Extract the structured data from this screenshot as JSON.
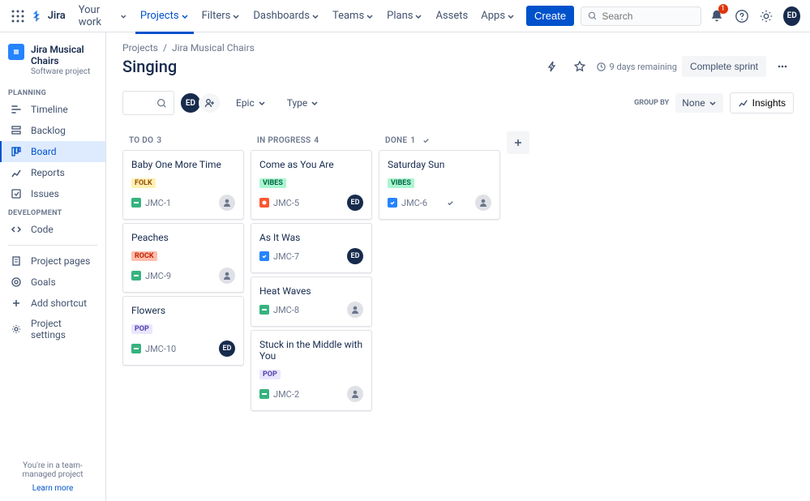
{
  "nav": {
    "logo": "Jira",
    "items": [
      "Your work",
      "Projects",
      "Filters",
      "Dashboards",
      "Teams",
      "Plans",
      "Assets",
      "Apps"
    ],
    "create": "Create",
    "search_placeholder": "Search",
    "notification_count": "1",
    "user_initials": "ED"
  },
  "sidebar": {
    "project_name": "Jira Musical Chairs",
    "project_type": "Software project",
    "sections": {
      "planning": "Planning",
      "development": "Development"
    },
    "planning_items": [
      "Timeline",
      "Backlog",
      "Board",
      "Reports",
      "Issues"
    ],
    "dev_items": [
      "Code"
    ],
    "bottom_items": [
      "Project pages",
      "Goals",
      "Add shortcut",
      "Project settings"
    ],
    "footer_text": "You're in a team-managed project",
    "footer_link": "Learn more"
  },
  "breadcrumb": {
    "root": "Projects",
    "project": "Jira Musical Chairs"
  },
  "page": {
    "title": "Singing",
    "days_remaining": "9 days remaining",
    "complete_sprint": "Complete sprint"
  },
  "toolbar": {
    "epic": "Epic",
    "type": "Type",
    "group_by_label": "Group by",
    "group_by_value": "None",
    "insights": "Insights",
    "avatar_initials": "ED"
  },
  "columns": [
    {
      "name": "To do",
      "count": "3",
      "cards": [
        {
          "title": "Baby One More Time",
          "epic": "Folk",
          "epic_class": "tag-folk",
          "type": "story",
          "key": "JMC-1",
          "assignee": "un"
        },
        {
          "title": "Peaches",
          "epic": "Rock",
          "epic_class": "tag-rock",
          "type": "story",
          "key": "JMC-9",
          "assignee": "un"
        },
        {
          "title": "Flowers",
          "epic": "Pop",
          "epic_class": "tag-pop",
          "type": "story",
          "key": "JMC-10",
          "assignee": "ed"
        }
      ]
    },
    {
      "name": "In progress",
      "count": "4",
      "cards": [
        {
          "title": "Come as You Are",
          "epic": "Vibes",
          "epic_class": "tag-vibes",
          "type": "bug",
          "key": "JMC-5",
          "assignee": "ed"
        },
        {
          "title": "As It Was",
          "epic": null,
          "type": "task",
          "key": "JMC-7",
          "assignee": "ed"
        },
        {
          "title": "Heat Waves",
          "epic": null,
          "type": "story",
          "key": "JMC-8",
          "assignee": "un"
        },
        {
          "title": "Stuck in the Middle with You",
          "epic": "Pop",
          "epic_class": "tag-pop",
          "type": "story",
          "key": "JMC-2",
          "assignee": "un"
        }
      ]
    },
    {
      "name": "Done",
      "count": "1",
      "done": true,
      "cards": [
        {
          "title": "Saturday Sun",
          "epic": "Vibes",
          "epic_class": "tag-vibes",
          "type": "task",
          "key": "JMC-6",
          "assignee": "un",
          "done": true
        }
      ]
    }
  ]
}
